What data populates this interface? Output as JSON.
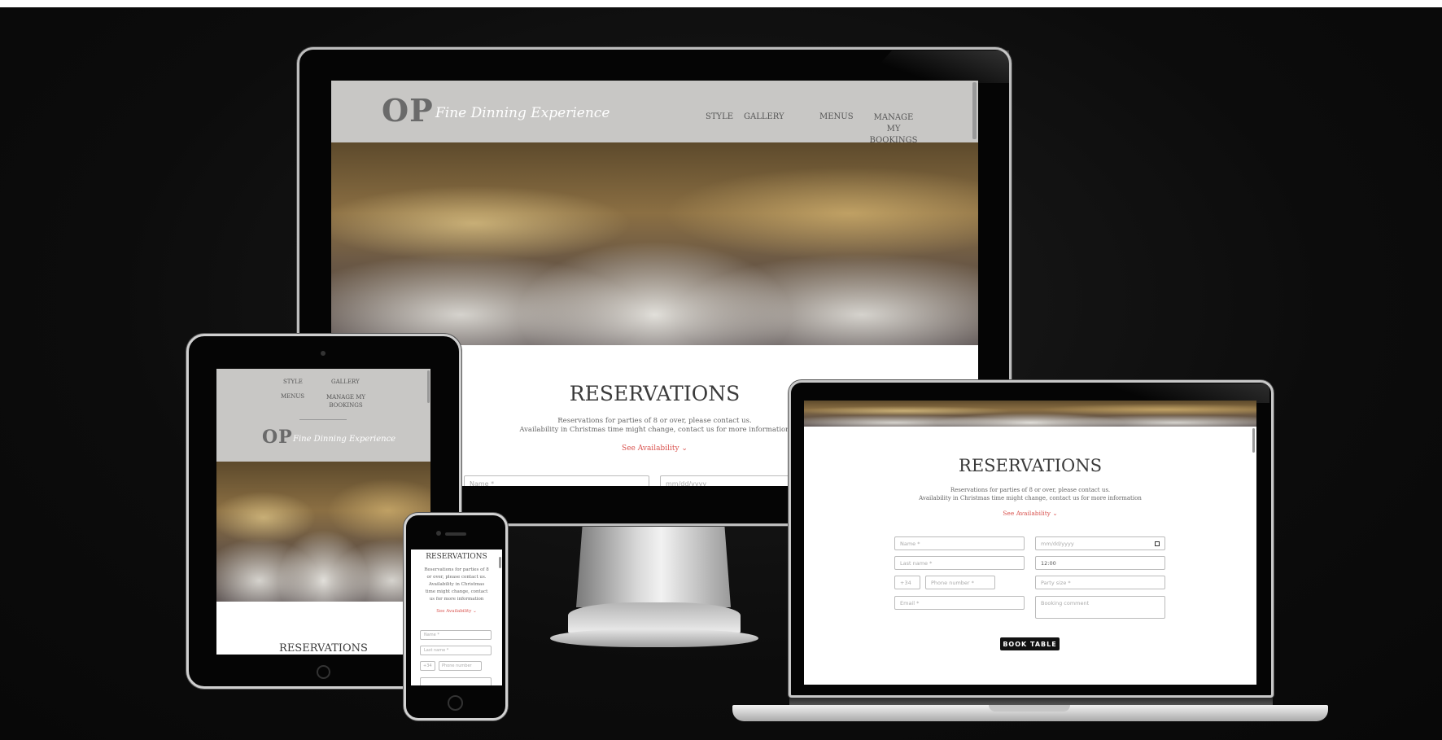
{
  "brand": {
    "logo": "OP",
    "tagline": "Fine Dinning Experience"
  },
  "nav": {
    "style": "STYLE",
    "gallery": "GALLERY",
    "menus": "MENUS",
    "manage_line1": "MANAGE MY",
    "manage_line2": "BOOKINGS"
  },
  "reservations": {
    "title": "RESERVATIONS",
    "line1": "Reservations for parties of 8 or over, please contact us.",
    "line2": "Availability in Christmas time might change, contact us for more information",
    "see_availability": "See Availability ⌄"
  },
  "phone_text": {
    "l1": "Reservations for parties of 8",
    "l2": "or over, please contact us.",
    "l3": "Availability in Christmas",
    "l4": "time might change, contact",
    "l5": "us for more information"
  },
  "form": {
    "name": "Name *",
    "date": "mm/dd/yyyy",
    "last_name": "Last name *",
    "time": "12:00",
    "country_code": "+34",
    "phone": "Phone number *",
    "phone_short": "Phone number",
    "party_size": "Party size *",
    "email": "Email *",
    "comment": "Booking comment",
    "submit": "BOOK TABLE"
  },
  "colors": {
    "accent": "#d9534f",
    "header_bg": "#c8c7c5",
    "page_bg": "#0c0c0c"
  }
}
